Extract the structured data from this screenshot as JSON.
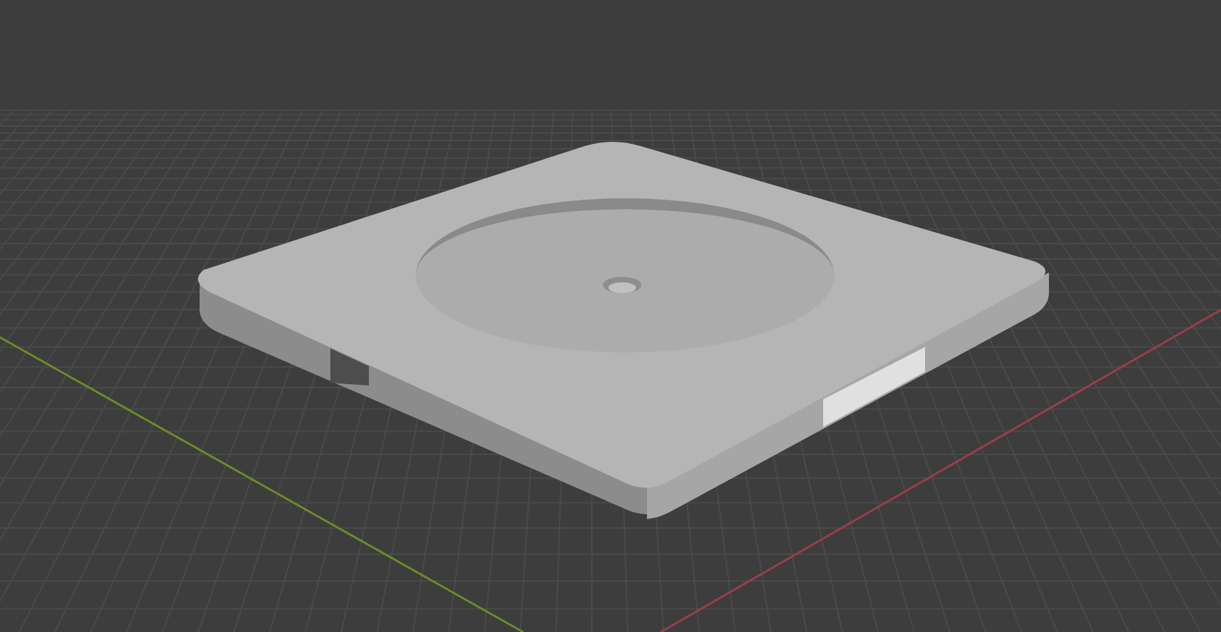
{
  "viewport": {
    "grid": true,
    "axes": [
      {
        "kind": "x",
        "color": "#9a3f4a"
      },
      {
        "kind": "y",
        "color": "#6b8c2a"
      }
    ],
    "model": {
      "kind": "plate"
    }
  }
}
